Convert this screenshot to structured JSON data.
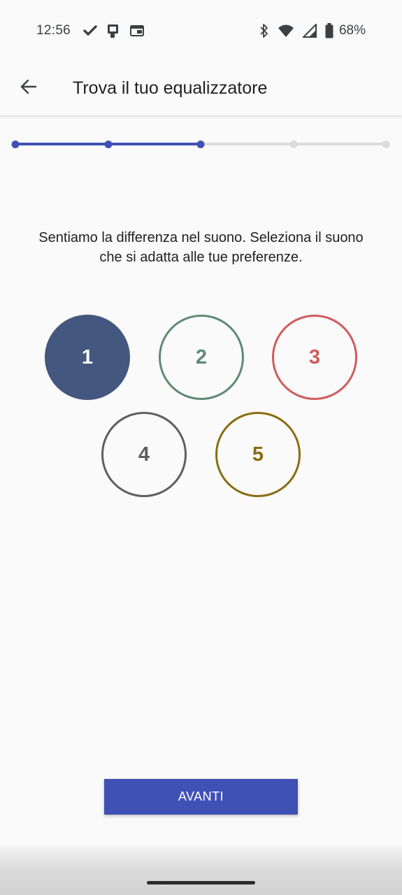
{
  "status_bar": {
    "time": "12:56",
    "battery_percent": "68%",
    "left_icons": [
      "check-icon",
      "sim-icon",
      "cast-icon"
    ],
    "right_icons": [
      "bluetooth-icon",
      "wifi-icon",
      "signal-icon",
      "battery-icon"
    ]
  },
  "app_bar": {
    "title": "Trova il tuo equalizzatore",
    "back_icon": "arrow-left-icon"
  },
  "stepper": {
    "total_steps": 5,
    "current_step": 3,
    "active_color": "#3f51b5",
    "inactive_color": "#dcdcdc"
  },
  "prompt": {
    "text": "Sentiamo la differenza nel suono. Seleziona il suono che si adatta alle tue preferenze."
  },
  "options": [
    {
      "label": "1",
      "color": "#44577f",
      "selected": true
    },
    {
      "label": "2",
      "color": "#5e8a73",
      "selected": false
    },
    {
      "label": "3",
      "color": "#cf5c5c",
      "selected": false
    },
    {
      "label": "4",
      "color": "#5f5f5f",
      "selected": false
    },
    {
      "label": "5",
      "color": "#8a6d10",
      "selected": false
    }
  ],
  "actions": {
    "next_label": "AVANTI",
    "accent": "#3f51b5"
  }
}
